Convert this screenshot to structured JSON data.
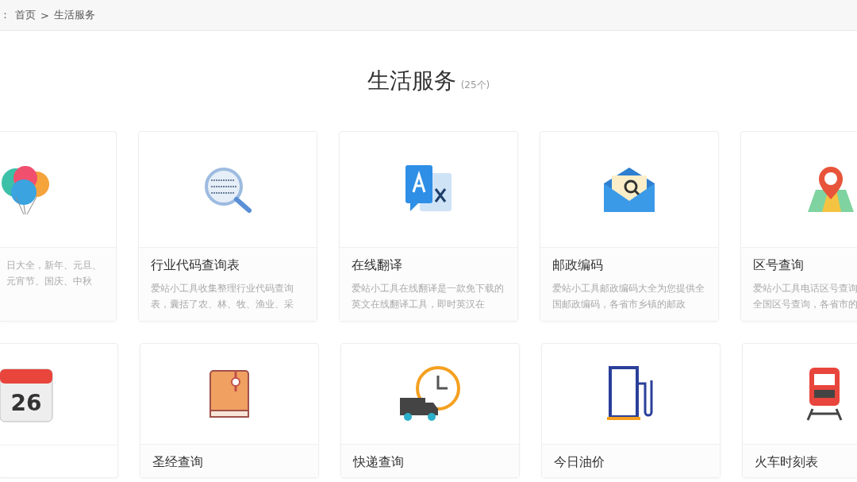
{
  "breadcrumb": {
    "label": "：",
    "link": "首页",
    "separator": ">",
    "current": "生活服务"
  },
  "heading": {
    "title": "生活服务",
    "count": "(25个)"
  },
  "rows": [
    {
      "cards": [
        {
          "description": "日大全，新年、元旦、元宵节、国庆、中秋"
        },
        {
          "title": "行业代码查询表",
          "description": "爱站小工具收集整理行业代码查询表，囊括了农、林、牧、渔业、采"
        },
        {
          "title": "在线翻译",
          "description": "爱站小工具在线翻译是一款免下载的英文在线翻译工具，即时英汉在"
        },
        {
          "title": "邮政编码",
          "description": "爱站小工具邮政编码大全为您提供全国邮政编码，各省市乡镇的邮政"
        },
        {
          "title": "区号查询",
          "description": "爱站小工具电话区号查询全国区号查询，各省市的"
        }
      ]
    },
    {
      "cards": [
        {
          "icon_text": "26"
        },
        {
          "title": "圣经查询"
        },
        {
          "title": "快递查询"
        },
        {
          "title": "今日油价"
        },
        {
          "title": "火车时刻表"
        }
      ]
    }
  ]
}
